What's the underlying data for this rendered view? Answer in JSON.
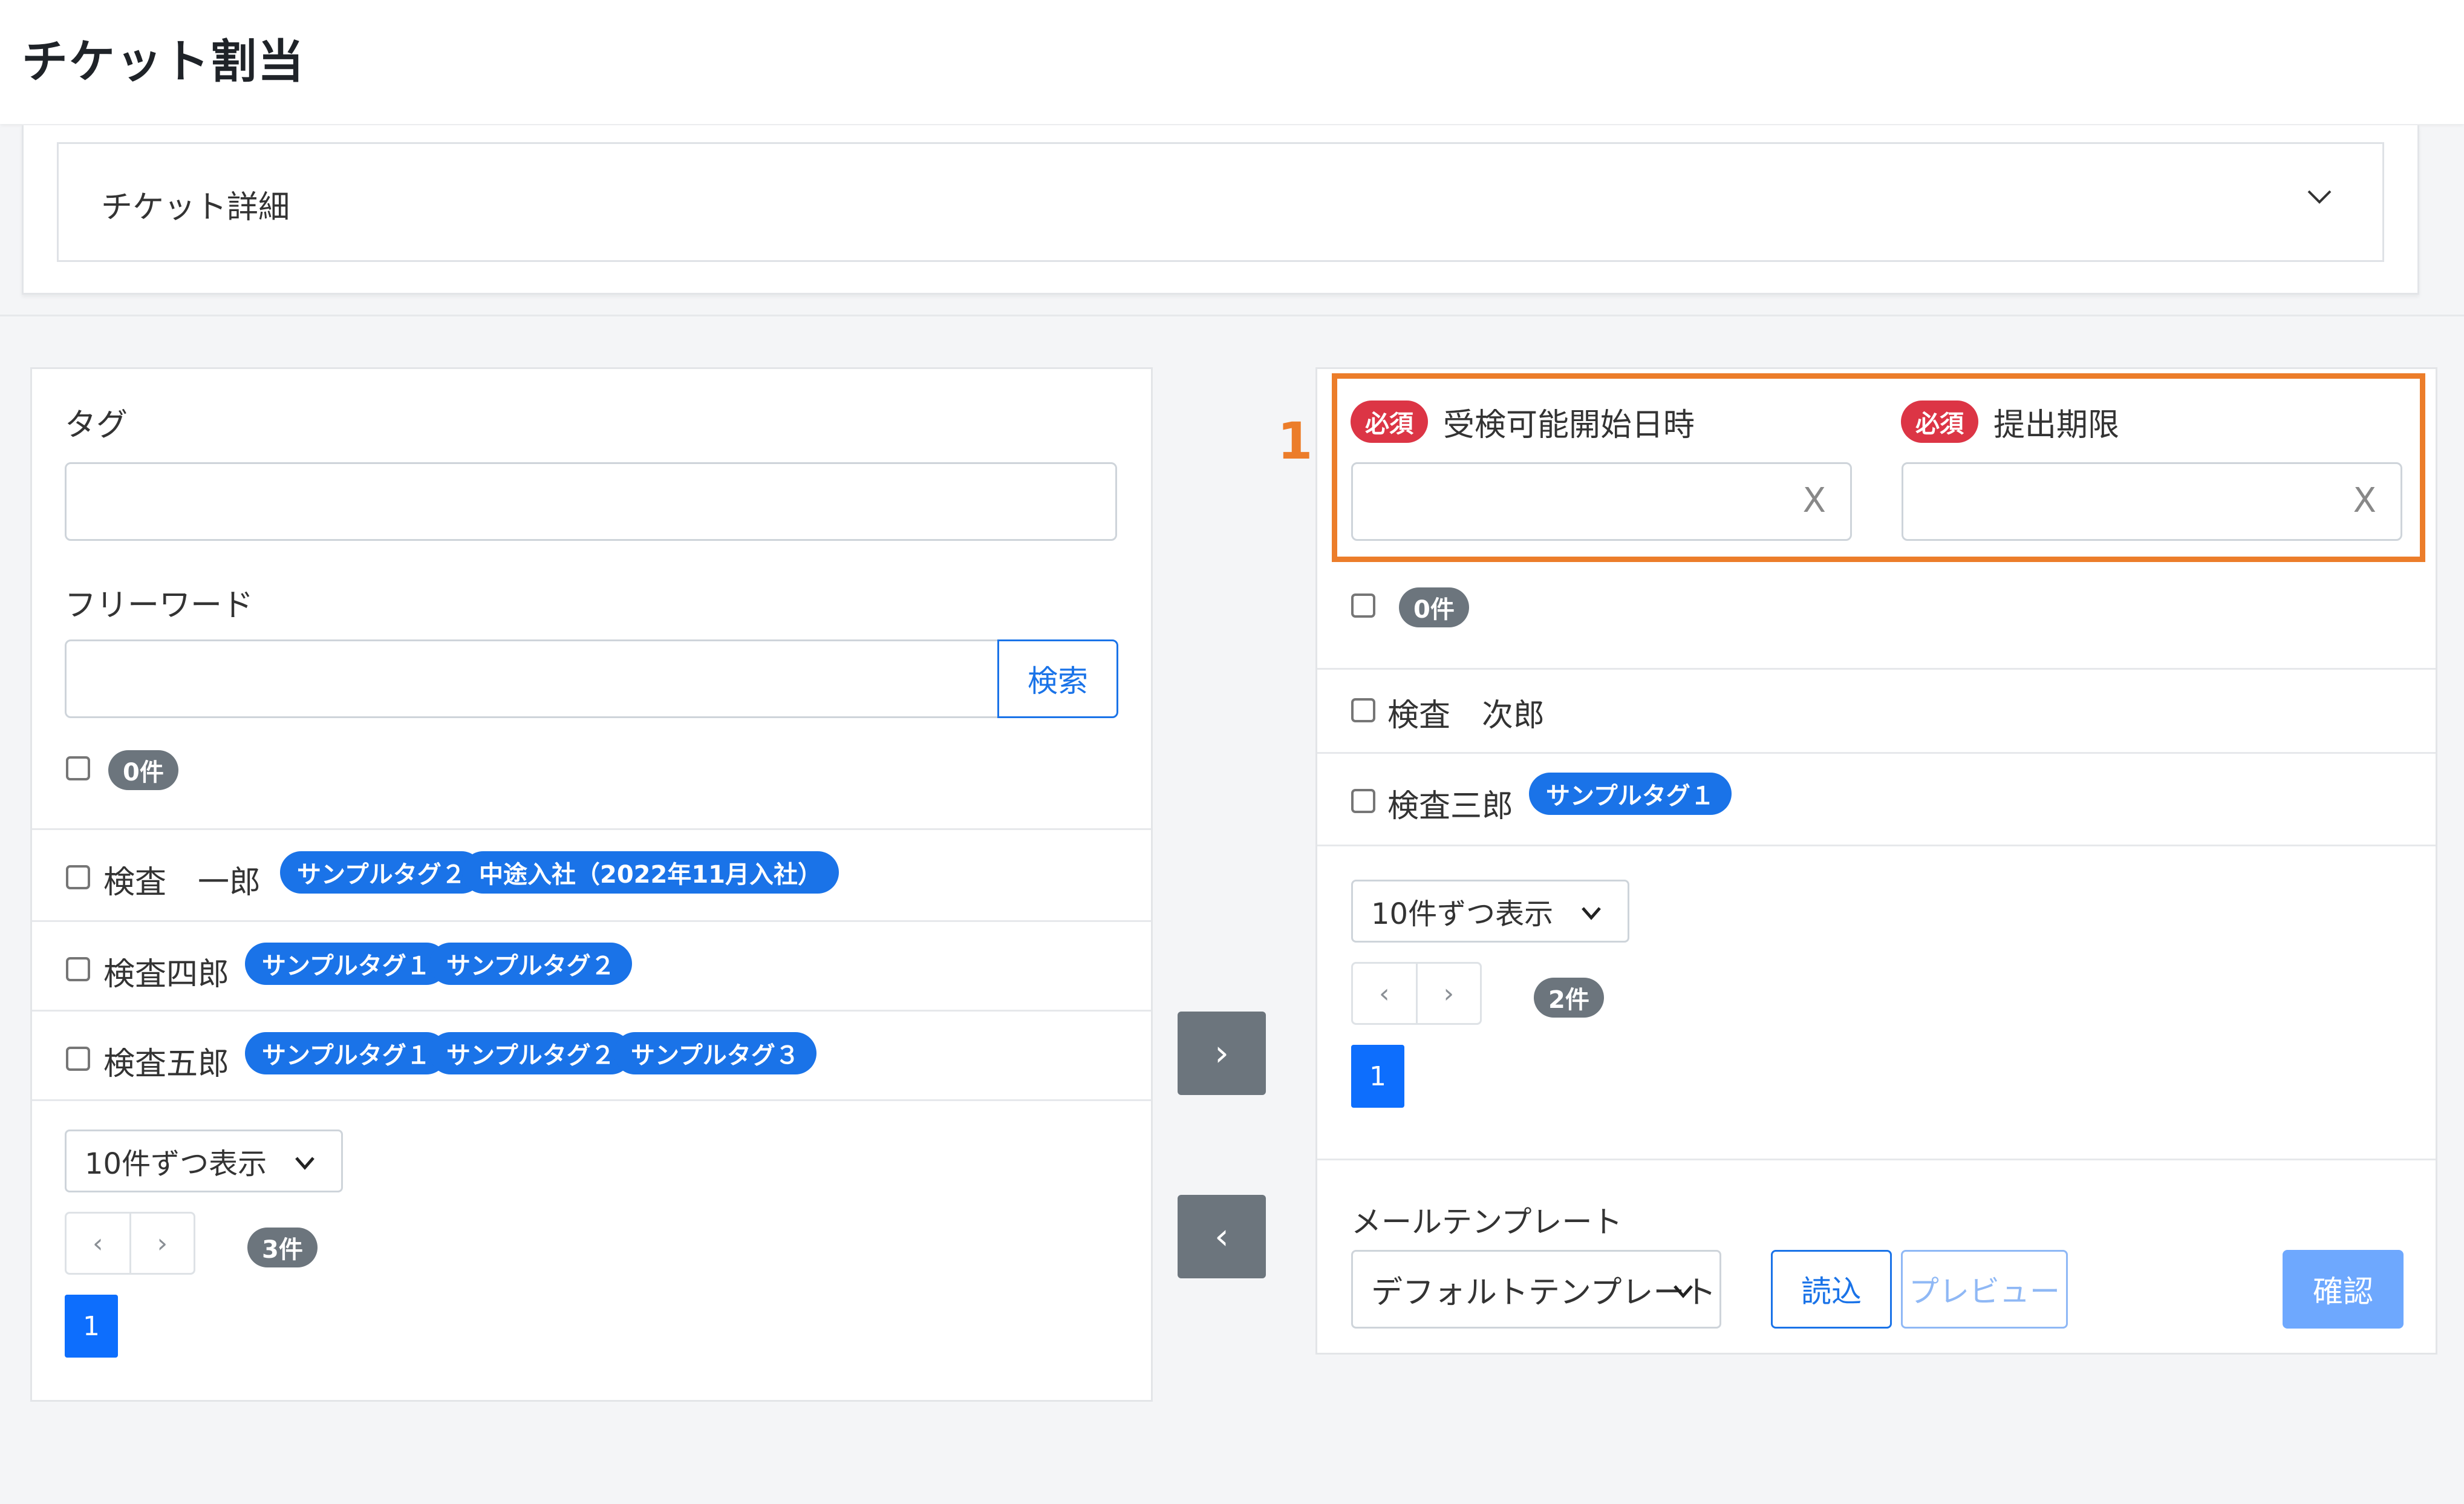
{
  "header": {
    "title": "チケット割当"
  },
  "ticket_detail": {
    "label": "チケット詳細"
  },
  "left": {
    "tag_label": "タグ",
    "freeword_label": "フリーワード",
    "search_button": "検索",
    "count_badge": "0件",
    "rows": [
      {
        "name": "検査　一郎",
        "tags": [
          "サンプルタグ２",
          "中途入社（2022年11月入社）"
        ]
      },
      {
        "name": "検査四郎",
        "tags": [
          "サンプルタグ１",
          "サンプルタグ２"
        ]
      },
      {
        "name": "検査五郎",
        "tags": [
          "サンプルタグ１",
          "サンプルタグ２",
          "サンプルタグ３"
        ]
      }
    ],
    "page_size": "10件ずつ表示",
    "prev": "‹",
    "next": "›",
    "total": "3件",
    "current_page": "1"
  },
  "move": {
    "right": "›",
    "left": "‹"
  },
  "right": {
    "callout": "1",
    "required": "必須",
    "start_label": "受検可能開始日時",
    "deadline_label": "提出期限",
    "clear_symbol": "X",
    "count_badge": "0件",
    "rows": [
      {
        "name": "検査　次郎",
        "tags": []
      },
      {
        "name": "検査三郎",
        "tags": [
          "サンプルタグ１"
        ]
      }
    ],
    "page_size": "10件ずつ表示",
    "prev": "‹",
    "next": "›",
    "total": "2件",
    "current_page": "1",
    "mail_template_label": "メールテンプレート",
    "mail_template_value": "デフォルトテンプレート",
    "load_button": "読込",
    "preview_button": "プレビュー",
    "confirm_button": "確認"
  }
}
